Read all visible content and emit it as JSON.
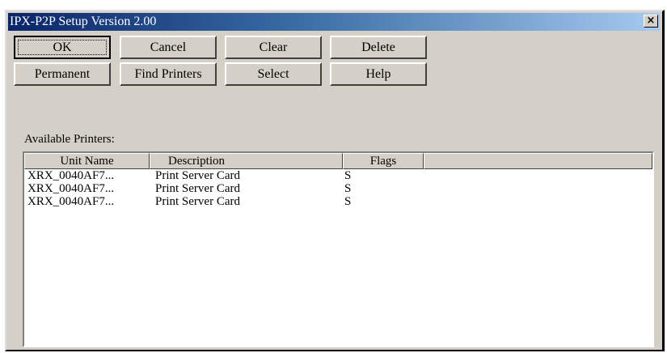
{
  "window": {
    "title": "IPX-P2P Setup Version 2.00",
    "close_glyph": "×"
  },
  "buttons": {
    "ok": "OK",
    "cancel": "Cancel",
    "clear": "Clear",
    "delete": "Delete",
    "permanent": "Permanent",
    "find_printers": "Find Printers",
    "select": "Select",
    "help": "Help"
  },
  "available_label": "Available Printers:",
  "list": {
    "columns": [
      "Unit Name",
      "Description",
      "Flags",
      ""
    ],
    "rows": [
      {
        "unit": "XRX_0040AF7...",
        "description": "Print Server Card",
        "flags": "S"
      },
      {
        "unit": "XRX_0040AF7...",
        "description": "Print Server Card",
        "flags": "S"
      },
      {
        "unit": "XRX_0040AF7...",
        "description": "Print Server Card",
        "flags": "S"
      }
    ]
  },
  "colors": {
    "face": "#d4d0c8",
    "title_start": "#0a246a",
    "title_end": "#a6caf0"
  }
}
